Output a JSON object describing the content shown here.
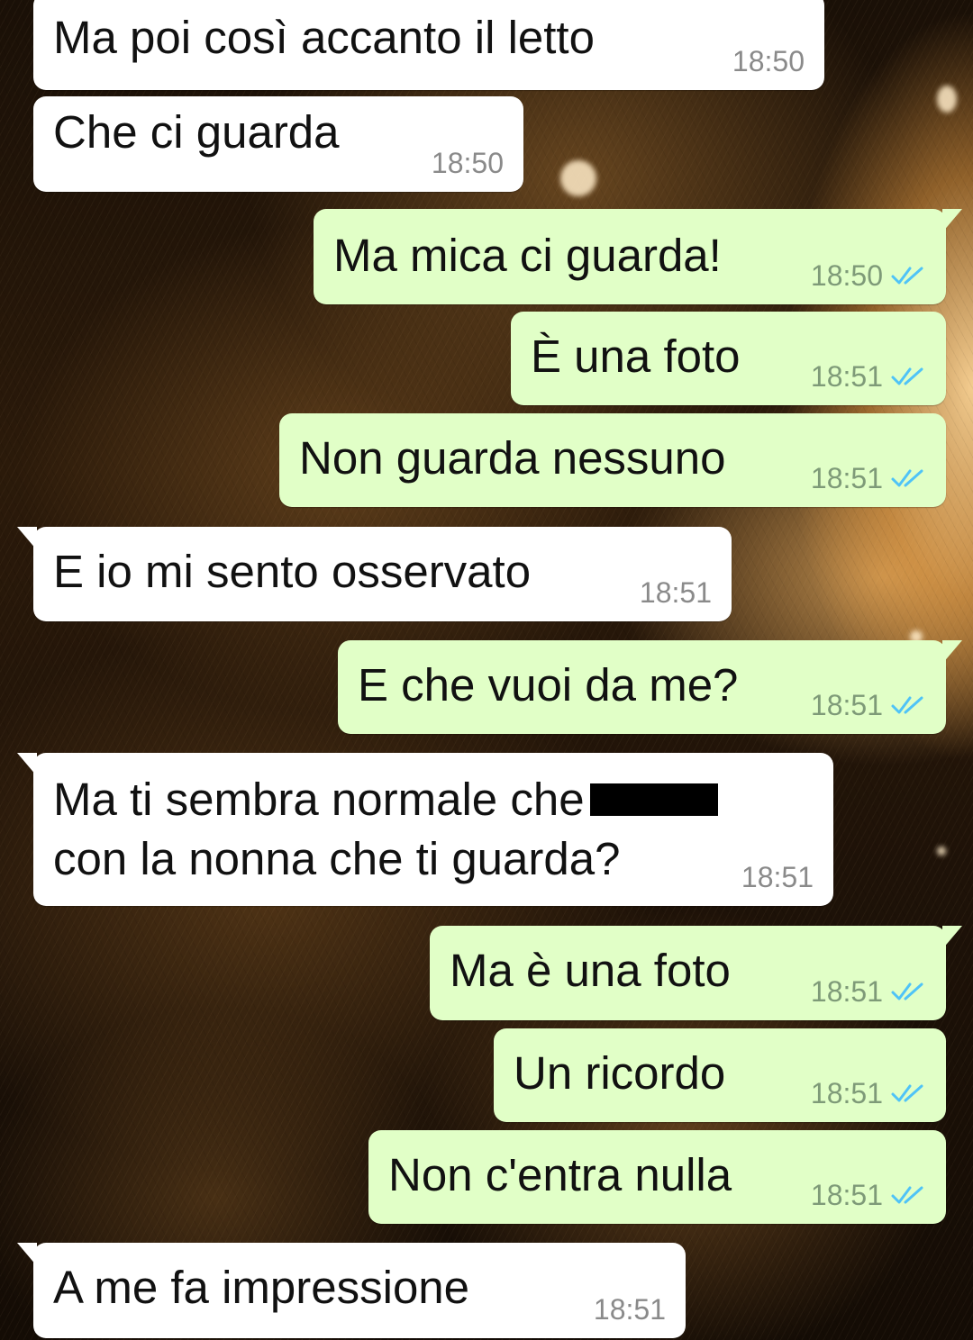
{
  "colors": {
    "incoming_bubble": "#ffffff",
    "outgoing_bubble": "#e1ffc7",
    "read_ticks": "#4fc3f7",
    "time_incoming": "#8a8a8a",
    "time_outgoing": "#7e9a78"
  },
  "icons": {
    "read_receipt": "double-check-icon"
  },
  "messages": [
    {
      "side": "in",
      "text": "Ma poi così accanto il letto",
      "time": "18:50"
    },
    {
      "side": "in",
      "text": "Che ci guarda",
      "time": "18:50"
    },
    {
      "side": "out",
      "text": "Ma mica ci guarda!",
      "time": "18:50",
      "status": "read"
    },
    {
      "side": "out",
      "text": "È una foto",
      "time": "18:51",
      "status": "read"
    },
    {
      "side": "out",
      "text": "Non guarda nessuno",
      "time": "18:51",
      "status": "read"
    },
    {
      "side": "in",
      "text": "E io mi sento osservato",
      "time": "18:51"
    },
    {
      "side": "out",
      "text": "E che vuoi da me?",
      "time": "18:51",
      "status": "read"
    },
    {
      "side": "in",
      "text_line1": "Ma ti sembra normale che",
      "text_line2": "con la nonna che ti guarda?",
      "redacted": true,
      "time": "18:51"
    },
    {
      "side": "out",
      "text": "Ma è una foto",
      "time": "18:51",
      "status": "read"
    },
    {
      "side": "out",
      "text": "Un ricordo",
      "time": "18:51",
      "status": "read"
    },
    {
      "side": "out",
      "text": "Non c'entra nulla",
      "time": "18:51",
      "status": "read"
    },
    {
      "side": "in",
      "text": "A me fa impressione",
      "time": "18:51"
    }
  ]
}
